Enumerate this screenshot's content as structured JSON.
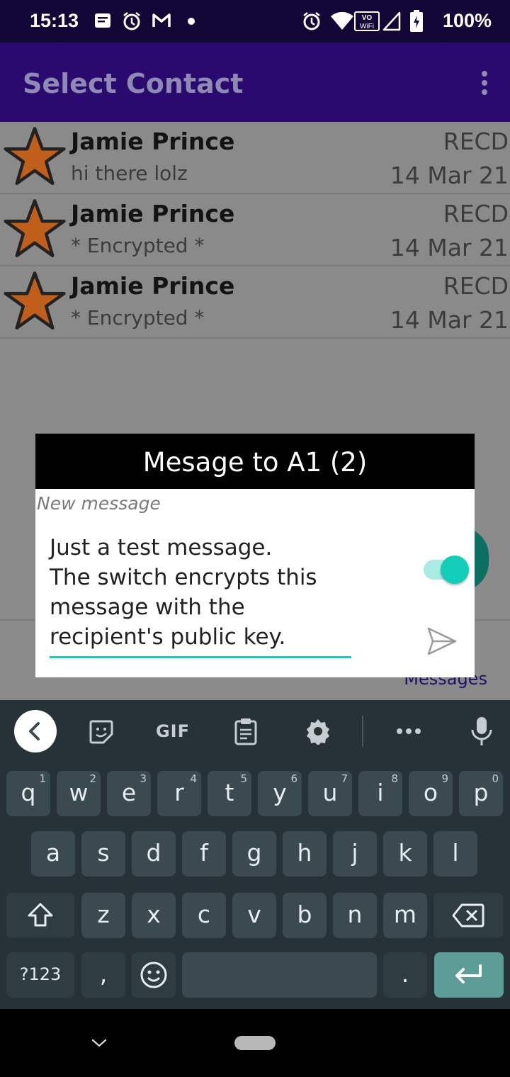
{
  "status_bar": {
    "time": "15:13",
    "battery": "100%",
    "left_icons": [
      "notification-icon",
      "alarm-icon",
      "gmail-icon",
      "dot-icon"
    ],
    "right_icons": [
      "alarm-icon",
      "wifi-icon",
      "vowifi-icon",
      "signal-icon",
      "battery-icon"
    ]
  },
  "app_bar": {
    "title": "Select Contact",
    "overflow_icon": "more-vert-icon"
  },
  "contacts": [
    {
      "name": "Jamie Prince",
      "preview": "hi there lolz",
      "status": "RECD",
      "date": "14 Mar 21"
    },
    {
      "name": "Jamie Prince",
      "preview": "* Encrypted *",
      "status": "RECD",
      "date": "14 Mar 21"
    },
    {
      "name": "Jamie Prince",
      "preview": "* Encrypted *",
      "status": "RECD",
      "date": "14 Mar 21"
    }
  ],
  "background_link": "Messages",
  "dialog": {
    "title": "Mesage to A1 (2)",
    "field_label": "New message",
    "message": "Just a test message.\nThe switch encrypts this message with the recipient's public key.",
    "encrypt_switch_on": true,
    "send_icon": "send-icon"
  },
  "keyboard": {
    "toolbar": [
      "back-icon",
      "sticker-icon",
      "GIF",
      "clipboard-icon",
      "settings-icon",
      "more-icon",
      "mic-icon"
    ],
    "gif_label": "GIF",
    "row1": [
      {
        "k": "q",
        "h": "1"
      },
      {
        "k": "w",
        "h": "2"
      },
      {
        "k": "e",
        "h": "3"
      },
      {
        "k": "r",
        "h": "4"
      },
      {
        "k": "t",
        "h": "5"
      },
      {
        "k": "y",
        "h": "6"
      },
      {
        "k": "u",
        "h": "7"
      },
      {
        "k": "i",
        "h": "8"
      },
      {
        "k": "o",
        "h": "9"
      },
      {
        "k": "p",
        "h": "0"
      }
    ],
    "row2": [
      "a",
      "s",
      "d",
      "f",
      "g",
      "h",
      "j",
      "k",
      "l"
    ],
    "row3": [
      "z",
      "x",
      "c",
      "v",
      "b",
      "n",
      "m"
    ],
    "sym_label": "?123",
    "comma": ",",
    "period": "."
  },
  "colors": {
    "app_bar": "#2a0a6e",
    "accent": "#12cdb7",
    "keyboard": "#263238",
    "star": "#c05e1b"
  }
}
